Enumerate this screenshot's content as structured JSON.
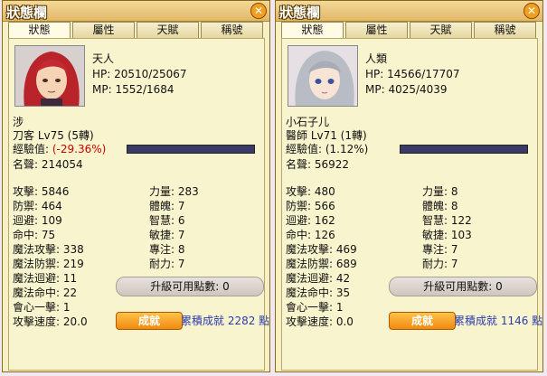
{
  "left": {
    "title": "狀態欄",
    "tabs": [
      "狀態",
      "屬性",
      "天賦",
      "稱號"
    ],
    "race": "天人",
    "hp": "HP: 20510/25067",
    "mp": "MP: 1552/1684",
    "name": "涉",
    "job": "刀客 Lv75 (5轉)",
    "exp_label": "經驗值: ",
    "exp_value": "(-29.36%)",
    "fame": "名聲: 214054",
    "stats_left": [
      "攻擊: 5846",
      "防禦: 464",
      "迴避: 109",
      "命中: 75",
      "魔法攻擊: 338",
      "魔法防禦: 219",
      "魔法迴避: 11",
      "魔法命中: 22",
      "會心一擊: 1",
      "攻擊速度: 20.0"
    ],
    "stats_right": [
      "力量: 283",
      "體魄: 7",
      "智慧: 6",
      "敏捷: 7",
      "專注: 8",
      "耐力: 7"
    ],
    "upgrade_points": "升級可用點數: 0",
    "achievement_btn": "成就",
    "achievement_text": "累積成就 2282 點",
    "exp_fill": 0.0
  },
  "right": {
    "title": "狀態欄",
    "tabs": [
      "狀態",
      "屬性",
      "天賦",
      "稱號"
    ],
    "race": "人類",
    "hp": "HP: 14566/17707",
    "mp": "MP: 4025/4039",
    "name": "小石子儿",
    "job": "醫師 Lv71 (1轉)",
    "exp_label": "經驗值: ",
    "exp_value": "(1.12%)",
    "fame": "名聲: 56922",
    "stats_left": [
      "攻擊: 480",
      "防禦: 566",
      "迴避: 162",
      "命中: 126",
      "魔法攻擊: 469",
      "魔法防禦: 689",
      "魔法迴避: 42",
      "魔法命中: 35",
      "會心一擊: 1",
      "攻擊速度: 0.0"
    ],
    "stats_right": [
      "力量: 8",
      "體魄: 8",
      "智慧: 122",
      "敏捷: 103",
      "專注: 7",
      "耐力: 7"
    ],
    "upgrade_points": "升級可用點數: 0",
    "achievement_btn": "成就",
    "achievement_text": "累積成就 1146 點",
    "exp_fill": 0.0112
  }
}
